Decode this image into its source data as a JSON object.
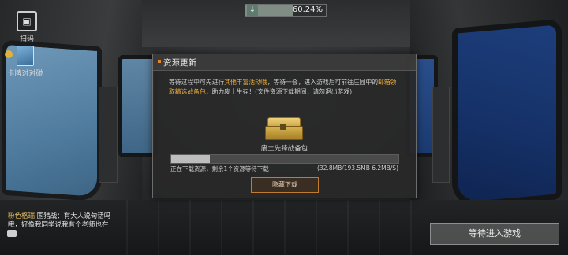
{
  "download": {
    "percent_text": "60.24%",
    "progress": 0.6024
  },
  "side": {
    "scan_label": "扫码",
    "card_label": "卡牌对对碰"
  },
  "dialog": {
    "title": "资源更新",
    "body_1": "等待过程中可先进行",
    "body_hl_1": "其他丰富活动哦",
    "body_2": "，等待一会，进入游戏后可前往庄园中的",
    "body_hl_2": "邮箱领取精选战备包",
    "body_3": "，助力废土生存！(文件资源下载期间，请勿退出游戏)",
    "pack_label": "废土先锋战备包",
    "progress": 0.17,
    "status_text": "正在下载资源，剩余1个资源等待下载",
    "size_text": "(32.8MB/193.5MB  6.2MB/S)",
    "hide_button": "隐藏下载"
  },
  "chat": {
    "name": "粉色格瑞",
    "text": " 围猎战：有大人说句话吗哦，好像我同学说我有个老师也在玩。"
  },
  "wait_button": "等待进入游戏",
  "colors": {
    "accent": "#f0b03a",
    "button_border": "#c17a2f"
  }
}
